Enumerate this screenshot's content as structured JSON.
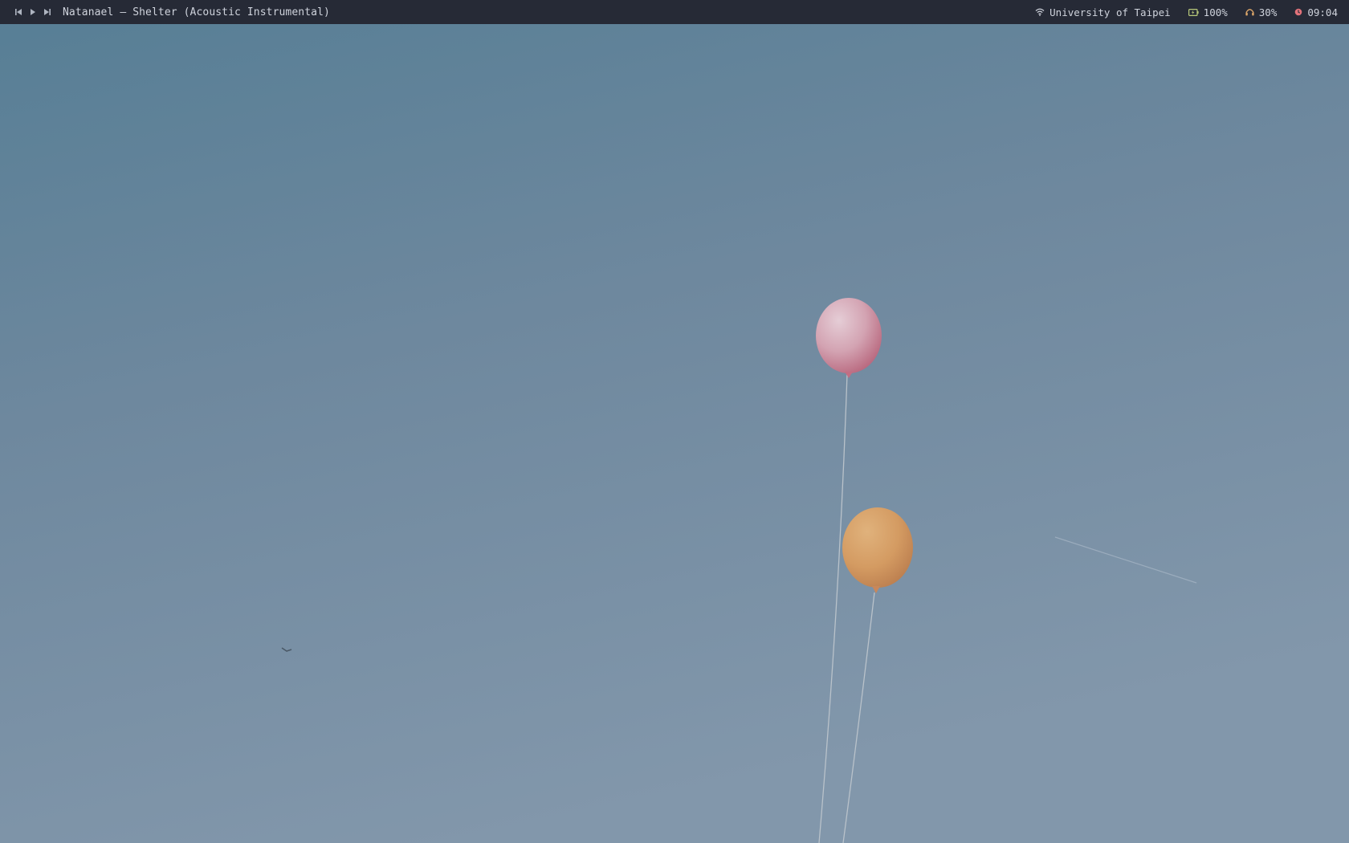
{
  "wallpaper": {
    "sky_top": "#577f96",
    "sky_mid": "#6e889e",
    "sky_bottom": "#8196aa",
    "balloon_pink": "#d3a3b2",
    "balloon_orange": "#d6a06a"
  },
  "topbar": {
    "background": "#262a36",
    "media": {
      "prev_icon": "skip-previous-icon",
      "play_icon": "play-icon",
      "next_icon": "skip-next-icon",
      "now_playing": "Natanael – Shelter (Acoustic Instrumental)"
    },
    "status": {
      "wifi": {
        "icon": "wifi-icon",
        "label": "University of Taipei",
        "color": "#cfd3dc"
      },
      "battery": {
        "icon": "battery-icon",
        "label": "100%",
        "color": "#b8c97a"
      },
      "volume": {
        "icon": "headphones-icon",
        "label": "30%",
        "color": "#e0a86a"
      },
      "clock": {
        "icon": "clock-icon",
        "label": "09:04",
        "color": "#e2727a"
      }
    }
  }
}
